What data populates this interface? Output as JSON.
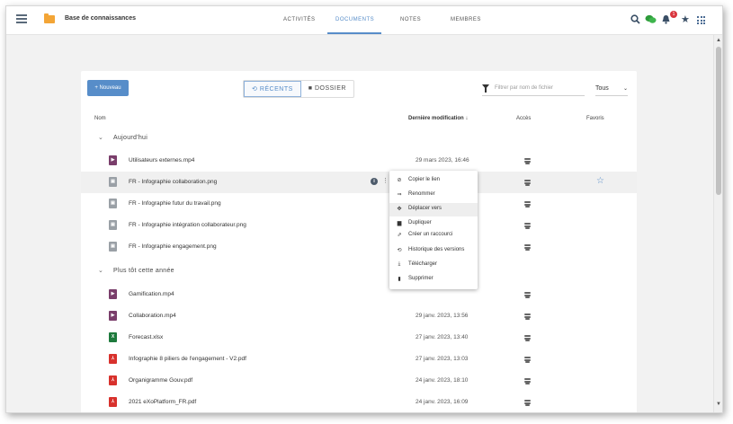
{
  "header": {
    "app_title": "Base de connaissances",
    "tabs": [
      {
        "label": "ACTIVITÉS"
      },
      {
        "label": "DOCUMENTS",
        "active": true
      },
      {
        "label": "NOTES"
      },
      {
        "label": "MEMBRES"
      }
    ],
    "notification_count": "1",
    "icons": [
      "menu-icon",
      "folder-icon",
      "search-icon",
      "chat-icon",
      "bell-icon",
      "star-icon",
      "apps-grid-icon"
    ]
  },
  "toolbar": {
    "new_label": "+ Nouveau",
    "recent_label": "RÉCENTS",
    "folder_label": "DOSSIER",
    "filter_placeholder": "Filtrer par nom de fichier",
    "filter_select": "Tous"
  },
  "table": {
    "columns": [
      "Nom",
      "Dernière modification",
      "Accès",
      "Favoris"
    ],
    "groups": [
      {
        "label": "Aujourd'hui",
        "rows": [
          {
            "name": "Utilisateurs externes.mp4",
            "type": "mp4",
            "date": "29 mars 2023, 16:46"
          },
          {
            "name": "FR - Infographie collaboration.png",
            "type": "png",
            "date": "",
            "highlighted": true
          },
          {
            "name": "FR - Infographie futur du travail.png",
            "type": "png",
            "date": ""
          },
          {
            "name": "FR - Infographie intégration collaborateur.png",
            "type": "png",
            "date": ""
          },
          {
            "name": "FR - Infographie engagement.png",
            "type": "png",
            "date": ""
          }
        ]
      },
      {
        "label": "Plus tôt cette année",
        "rows": [
          {
            "name": "Gamification.mp4",
            "type": "mp4",
            "date": ""
          },
          {
            "name": "Collaboration.mp4",
            "type": "mp4",
            "date": "29 janv. 2023, 13:56"
          },
          {
            "name": "Forecast.xlsx",
            "type": "xlsx",
            "date": "27 janv. 2023, 13:40"
          },
          {
            "name": "Infographie 8 piliers de l'engagement - V2.pdf",
            "type": "pdf",
            "date": "27 janv. 2023, 13:03"
          },
          {
            "name": "Organigramme Gouv.pdf",
            "type": "pdf",
            "date": "24 janv. 2023, 18:10"
          },
          {
            "name": "2021 eXoPlatform_FR.pdf",
            "type": "pdf",
            "date": "24 janv. 2023, 16:09"
          }
        ]
      }
    ]
  },
  "context_menu": {
    "items": [
      {
        "label": "Copier le lien",
        "icon": "link-icon"
      },
      {
        "label": "Renommer",
        "icon": "rename-icon"
      },
      {
        "label": "Déplacer vers",
        "icon": "move-icon",
        "hover": true
      },
      {
        "label": "Dupliquer",
        "icon": "duplicate-icon"
      },
      {
        "label": "Créer un raccourci",
        "icon": "shortcut-icon"
      },
      {
        "label": "Historique des versions",
        "icon": "history-icon"
      },
      {
        "label": "Télécharger",
        "icon": "download-icon"
      },
      {
        "label": "Supprimer",
        "icon": "trash-icon"
      }
    ]
  },
  "colors": {
    "accent": "#578dc9",
    "badge": "#d9363e",
    "folder": "#f3a536"
  }
}
